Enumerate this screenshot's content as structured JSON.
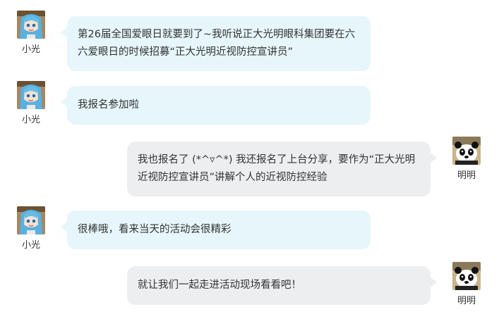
{
  "users": {
    "left": {
      "name": "小光",
      "avatar_icon": "blue-hair-anime-girl-icon"
    },
    "right": {
      "name": "明明",
      "avatar_icon": "panda-icon"
    }
  },
  "colors": {
    "left_bubble": "#e6f6fb",
    "right_bubble": "#eceef0",
    "text": "#333333"
  },
  "messages": [
    {
      "side": "left",
      "author": "小光",
      "text": "第26届全国爱眼日就要到了~我听说正大光明眼科集团要在六六爱眼日的时候招募“正大光明近视防控宣讲员”"
    },
    {
      "side": "left",
      "author": "小光",
      "text": "我报名参加啦"
    },
    {
      "side": "right",
      "author": "明明",
      "text": "我也报名了 (*^▿^*) 我还报名了上台分享，要作为“正大光明近视防控宣讲员”讲解个人的近视防控经验"
    },
    {
      "side": "left",
      "author": "小光",
      "text": "很棒哦，看来当天的活动会很精彩"
    },
    {
      "side": "right",
      "author": "明明",
      "text": "就让我们一起走进活动现场看看吧！"
    }
  ]
}
